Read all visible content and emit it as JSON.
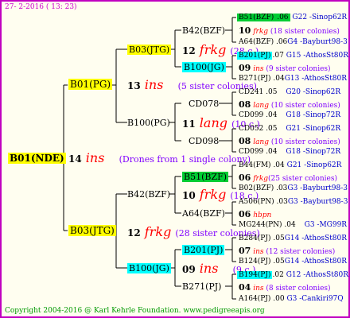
{
  "stamp": "27-  2-2016 ( 13: 23)",
  "root": "B01(NDE)",
  "root_gen": "14",
  "root_ins": "ins",
  "root_note": "(Drones from 1 single colony)",
  "p_top": {
    "name": "B01(PG)",
    "gen": "13",
    "ins": "ins",
    "note": "(5 sister colonies)"
  },
  "p_bot": {
    "name": "B03(JTG)",
    "gen": "12",
    "ins": "frkg",
    "note": "(28 sister colonies)"
  },
  "n_b03": {
    "name": "B03(JTG)",
    "gen": "12",
    "ins": "frkg",
    "note": "(28 c.)"
  },
  "n_b100pg": {
    "name": "B100(PG)",
    "gen": "11",
    "ins": "lang",
    "note": "(10 c.)"
  },
  "n_b42": {
    "name": "B42(BZF)",
    "gen": "10",
    "ins": "frkg",
    "note": "(18 c.)"
  },
  "n_b100jg": {
    "name": "B100(JG)",
    "gen": "09",
    "ins": "ins",
    "note": "(9 c.)"
  },
  "l_b42": "B42(BZF)",
  "l_b100jg": "B100(JG)",
  "l_cd078": "CD078",
  "l_cd098": "CD098",
  "l_b51": "B51(BZF)",
  "l_a64": "A64(BZF)",
  "l_b201": "B201(PJ)",
  "l_b271": "B271(PJ)",
  "rows": {
    "r1": {
      "name": "B51(BZF)",
      "num": ".06",
      "loc": "G22 -Sinop62R"
    },
    "r2": {
      "gen": "10",
      "ins": "frkg",
      "note": "(18 sister colonies)"
    },
    "r3": {
      "name": "A64(BZF)",
      "num": ".06",
      "loc": "G4 -Bayburt98-3"
    },
    "r4": {
      "name": "B201(PJ)",
      "num": ".07",
      "loc": "G15 -AthosSt80R"
    },
    "r5": {
      "gen": "09",
      "ins": "ins",
      "note": "(9 sister colonies)"
    },
    "r6": {
      "name": "B271(PJ)",
      "num": ".04",
      "loc": "G13 -AthosSt80R"
    },
    "r7": {
      "name": "CD241",
      "num": ".05",
      "loc": "G20 -Sinop62R"
    },
    "r8": {
      "gen": "08",
      "ins": "lang",
      "note": "(10 sister colonies)"
    },
    "r9": {
      "name": "CD099",
      "num": ".04",
      "loc": "G18 -Sinop72R"
    },
    "r10": {
      "name": "CD052",
      "num": ".05",
      "loc": "G21 -Sinop62R"
    },
    "r11": {
      "gen": "08",
      "ins": "lang",
      "note": "(10 sister colonies)"
    },
    "r12": {
      "name": "CD099",
      "num": ".04",
      "loc": "G18 -Sinop72R"
    },
    "r13": {
      "name": "B44(FM)",
      "num": ".04",
      "loc": "G21 -Sinop62R"
    },
    "r14": {
      "gen": "06",
      "ins": "frkg",
      "note": "(25 sister colonies)"
    },
    "r15": {
      "name": "B02(BZF)",
      "num": ".03",
      "loc": "G3 -Bayburt98-3"
    },
    "r16": {
      "name": "A506(PN)",
      "num": ".03",
      "loc": "G3 -Bayburt98-3"
    },
    "r17": {
      "gen": "06",
      "ins": "hbpn",
      "note": ""
    },
    "r18": {
      "name": "MG244(PN)",
      "num": ".04",
      "loc": "G3 -MG99R"
    },
    "r19": {
      "name": "B284(PJ)",
      "num": ".05",
      "loc": "G14 -AthosSt80R"
    },
    "r20": {
      "gen": "07",
      "ins": "ins",
      "note": "(12 sister colonies)"
    },
    "r21": {
      "name": "B124(PJ)",
      "num": ".05",
      "loc": "G14 -AthosSt80R"
    },
    "r22": {
      "name": "B194(PJ)",
      "num": ".02",
      "loc": "G12 -AthosSt80R"
    },
    "r23": {
      "gen": "04",
      "ins": "ins",
      "note": "(8 sister colonies)"
    },
    "r24": {
      "name": "A164(PJ)",
      "num": ".00",
      "loc": "G3 -Cankiri97Q"
    }
  },
  "footer": "Copyright 2004-2016 @ Karl Kehrle Foundation.   www.pedigreeapis.org",
  "colors": {
    "border": "#c000c0",
    "accent": "#ffff00",
    "green": "#00cc33",
    "cyan": "#00ffff",
    "red": "#ff0000",
    "note": "#8000ff",
    "blue": "#0000cc",
    "stamp": "#cc00cc"
  }
}
